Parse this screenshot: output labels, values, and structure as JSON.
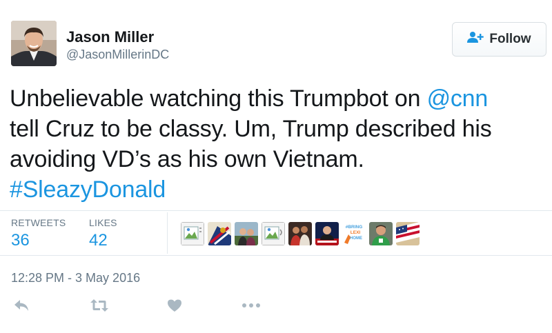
{
  "author": {
    "name": "Jason Miller",
    "handle": "@JasonMillerinDC"
  },
  "follow_button": {
    "label": "Follow",
    "icon": "add-user-icon"
  },
  "tweet": {
    "line1_text": "Unbelievable watching this Trumpbot on ",
    "mention": "@cnn",
    "line2": "tell Cruz to be classy. Um, Trump described his",
    "line3": "avoiding VD’s as his own Vietnam.",
    "hashtag": "#SleazyDonald"
  },
  "stats": {
    "retweets_label": "RETWEETS",
    "retweets_value": "36",
    "likes_label": "LIKES",
    "likes_value": "42"
  },
  "liker_avatars": [
    {
      "icon": "broken-image-icon"
    },
    {
      "icon": "avatar-flag-icon"
    },
    {
      "icon": "avatar-couple-icon"
    },
    {
      "icon": "broken-image-icon"
    },
    {
      "icon": "avatar-people-icon"
    },
    {
      "icon": "avatar-tv-icon"
    },
    {
      "icon": "avatar-bring-lexi-home-icon",
      "text": "#BRING LEXI HOME"
    },
    {
      "icon": "avatar-man-green-icon"
    },
    {
      "icon": "avatar-us-flag-icon"
    }
  ],
  "timestamp": "12:28 PM - 3 May 2016",
  "actions": [
    "reply-icon",
    "retweet-icon",
    "like-icon",
    "more-icon"
  ],
  "colors": {
    "link": "#1b95e0",
    "secondary_text": "#657786",
    "action_icon": "#aab8c2"
  }
}
